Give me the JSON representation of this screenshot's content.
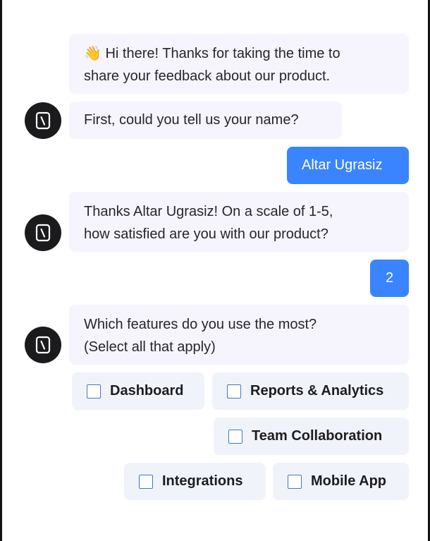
{
  "messages": {
    "greeting": {
      "emoji": "👋",
      "line1": "Hi there! Thanks for taking the time to",
      "line2": "share your feedback about our product."
    },
    "ask_name": "First, could you tell us your name?",
    "user_name": "Altar Ugrasiz",
    "ask_rating": {
      "line1": "Thanks Altar Ugrasiz! On a scale of 1-5,",
      "line2": "how satisfied are you with our product?"
    },
    "user_rating": "2",
    "ask_features": {
      "line1": "Which features do you use the most?",
      "line2": "(Select all that apply)"
    }
  },
  "feature_options": [
    {
      "label": "Dashboard",
      "checked": false
    },
    {
      "label": "Reports & Analytics",
      "checked": false
    },
    {
      "label": "Team Collaboration",
      "checked": false
    },
    {
      "label": "Integrations",
      "checked": false
    },
    {
      "label": "Mobile App",
      "checked": false
    }
  ],
  "colors": {
    "bot_bubble": "#f6f5fd",
    "user_bubble": "#3a84ff",
    "option_bg": "#f1f3fb",
    "avatar": "#1b1b1d",
    "checkbox_border": "#3f78c8"
  },
  "icons": {
    "bot_avatar": "bot-logo-icon"
  }
}
